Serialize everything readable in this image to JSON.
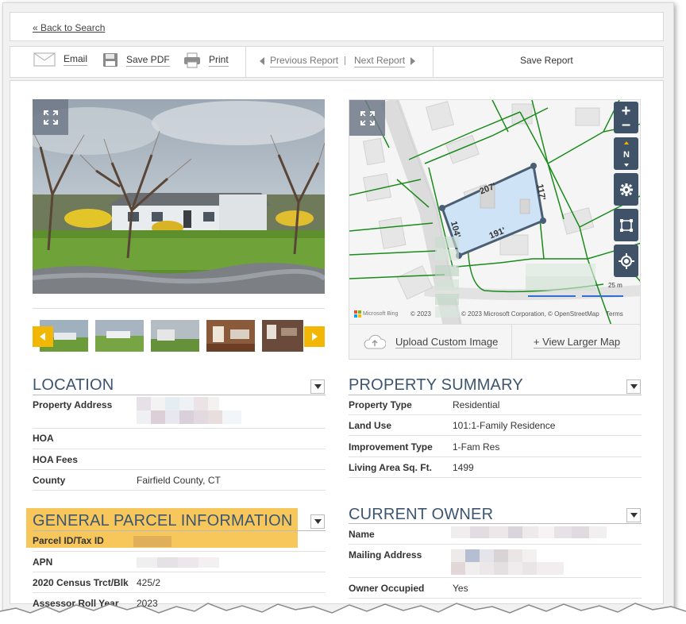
{
  "nav": {
    "back_label": "« Back to Search"
  },
  "toolbar": {
    "email_label": "Email",
    "pdf_label": "Save PDF",
    "print_label": "Print",
    "prev_label": "Previous Report",
    "next_label": "Next Report",
    "save_report_label": "Save Report"
  },
  "map": {
    "edge_labels": [
      "207'",
      "117'",
      "191'",
      "104'"
    ],
    "scale_label": "25 m",
    "attribution": "© 2023 Microsoft Corporation, © OpenStreetMap",
    "terms": "Terms",
    "bing_label": "Microsoft Bing",
    "bing_year": "© 2023",
    "north_label": "N",
    "upload_label": "Upload Custom Image",
    "larger_map_label": "+ View Larger Map"
  },
  "location": {
    "title": "LOCATION",
    "rows": [
      {
        "label": "Property Address",
        "value": ""
      },
      {
        "label": "HOA",
        "value": ""
      },
      {
        "label": "HOA Fees",
        "value": ""
      },
      {
        "label": "County",
        "value": "Fairfield County, CT"
      }
    ]
  },
  "parcel": {
    "title": "GENERAL PARCEL INFORMATION",
    "rows": [
      {
        "label": "Parcel ID/Tax ID",
        "value": ""
      },
      {
        "label": "APN",
        "value": ""
      },
      {
        "label": "2020 Census Trct/Blk",
        "value": "425/2"
      },
      {
        "label": "Assessor Roll Year",
        "value": "2023"
      }
    ]
  },
  "summary": {
    "title": "PROPERTY SUMMARY",
    "rows": [
      {
        "label": "Property Type",
        "value": "Residential"
      },
      {
        "label": "Land Use",
        "value": "101:1-Family Residence"
      },
      {
        "label": "Improvement Type",
        "value": "1-Fam Res"
      },
      {
        "label": "Living Area Sq. Ft.",
        "value": "1499"
      }
    ]
  },
  "owner": {
    "title": "CURRENT OWNER",
    "rows": [
      {
        "label": "Name",
        "value": ""
      },
      {
        "label": "Mailing Address",
        "value": ""
      },
      {
        "label": "Owner Occupied",
        "value": "Yes"
      }
    ]
  },
  "colors": {
    "section_title": "#3c5570",
    "highlight": "#f6c14a",
    "parcel_fill": "#cfe3f7",
    "parcel_stroke": "#4a5e74",
    "lot_lines": "#1a8a1a",
    "map_control": "#3f5268",
    "arrow_button": "#f2b705"
  },
  "icons": [
    "envelope-icon",
    "floppy-disk-icon",
    "printer-icon",
    "caret-left-icon",
    "caret-right-icon",
    "expand-icon",
    "zoom-in-icon",
    "zoom-out-icon",
    "compass-icon",
    "gear-icon",
    "select-area-icon",
    "locate-icon",
    "cloud-upload-icon",
    "chevron-down-icon"
  ]
}
